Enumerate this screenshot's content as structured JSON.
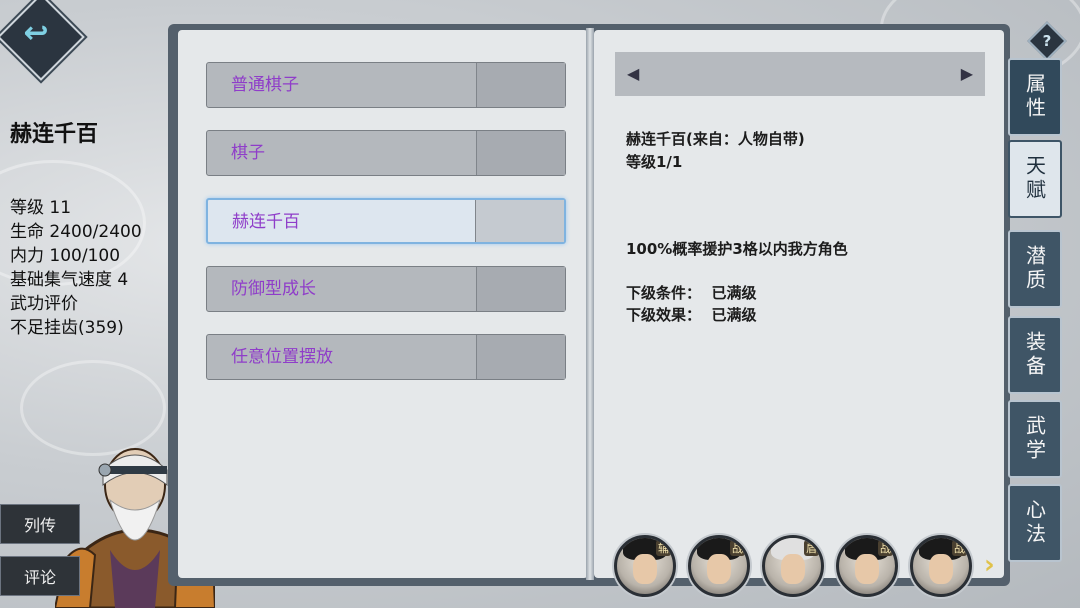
{
  "character": {
    "name": "赫连千百",
    "stats": [
      "等级 11",
      "生命 2400/2400",
      "内力 100/100",
      "基础集气速度 4",
      "武功评价",
      "不足挂齿(359)"
    ]
  },
  "side_buttons": {
    "biography": "列传",
    "comment": "评论"
  },
  "help_label": "?",
  "talents": [
    {
      "label": "普通棋子"
    },
    {
      "label": "棋子"
    },
    {
      "label": "赫连千百",
      "selected": true
    },
    {
      "label": "防御型成长"
    },
    {
      "label": "任意位置摆放"
    }
  ],
  "detail": {
    "source_line": "赫连千百(来自：人物自带)",
    "level_line": "等级1/1",
    "effect": "100%概率援护3格以内我方角色",
    "next_condition": "下级条件：  已满级",
    "next_effect": "下级效果：  已满级"
  },
  "nav": {
    "prev_icon": "prev-page-icon",
    "next_icon": "next-page-icon"
  },
  "tabs": [
    {
      "label": "属性",
      "state": "normal"
    },
    {
      "label": "天赋",
      "state": "active"
    },
    {
      "label": "潜质",
      "state": "normal"
    },
    {
      "label": "装备",
      "state": "normal"
    },
    {
      "label": "武学",
      "state": "normal"
    },
    {
      "label": "心法",
      "state": "normal"
    }
  ],
  "party": [
    {
      "badge": "辅"
    },
    {
      "badge": "战"
    },
    {
      "badge": "盾"
    },
    {
      "badge": "战"
    },
    {
      "badge": "战"
    }
  ],
  "colors": {
    "talent_text": "#8f3dc9",
    "tab_active": "#dfe6ec",
    "tab": "#3f5566"
  }
}
